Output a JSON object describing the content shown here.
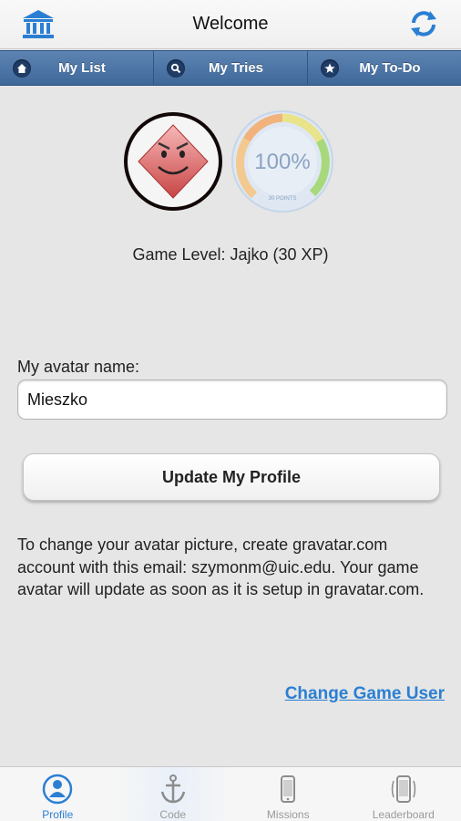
{
  "nav": {
    "title": "Welcome",
    "left_icon": "bank-icon",
    "right_icon": "refresh-icon",
    "accent": "#2b7fd3"
  },
  "segments": [
    {
      "label": "My List",
      "icon": "home-icon"
    },
    {
      "label": "My Tries",
      "icon": "search-icon"
    },
    {
      "label": "My To-Do",
      "icon": "star-icon"
    }
  ],
  "profile": {
    "progress_text": "100%",
    "progress_caption": "30 POINTS",
    "progress_value": 1.0,
    "game_level": "Game Level: Jajko (30 XP)",
    "avatar_label": "My avatar name:",
    "avatar_value": "Mieszko",
    "update_button": "Update My Profile",
    "info_text": "To change your avatar picture, create gravatar.com account with this email: szymonm@uic.edu. Your game avatar will update as soon as it is setup in gravatar.com.",
    "change_user_link": "Change Game User"
  },
  "tabs": [
    {
      "label": "Profile",
      "icon": "person-icon",
      "active": true
    },
    {
      "label": "Code",
      "icon": "anchor-icon",
      "active": false
    },
    {
      "label": "Missions",
      "icon": "phone-icon",
      "active": false
    },
    {
      "label": "Leaderboard",
      "icon": "phone-shake-icon",
      "active": false
    }
  ]
}
